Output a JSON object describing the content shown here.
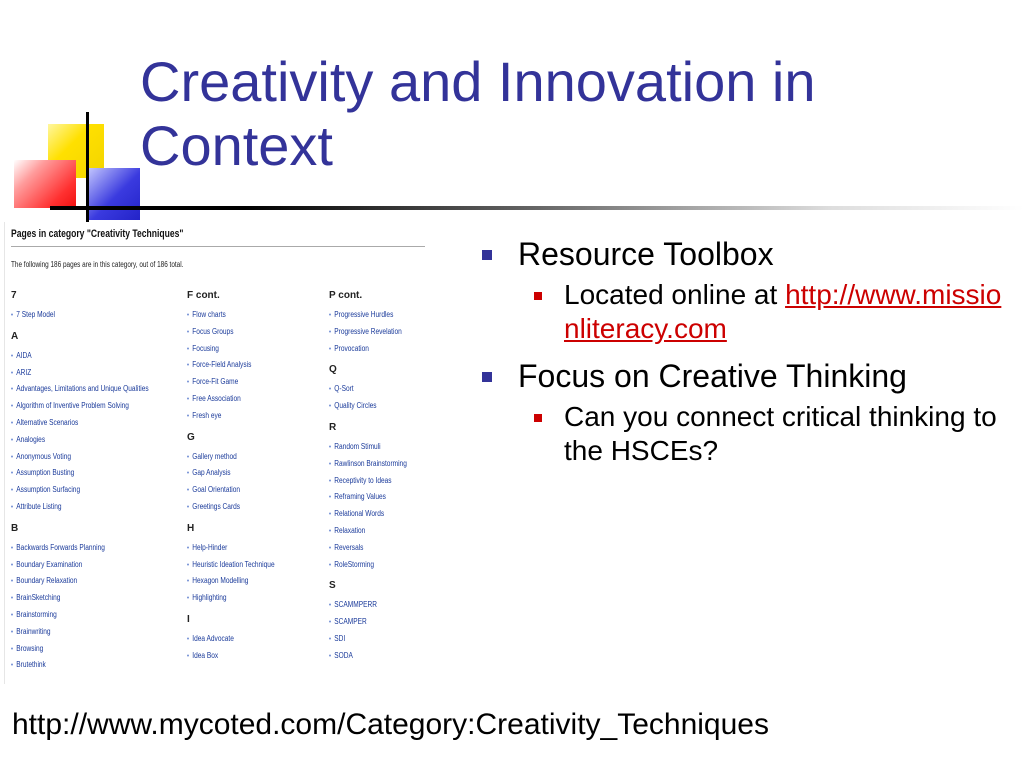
{
  "slide": {
    "title": "Creativity and Innovation in Context",
    "footer_url": "http://www.mycoted.com/Category:Creativity_Techniques",
    "accent_title": "#333399",
    "accent_bullet": "#333399",
    "accent_sub_bullet": "#cc0000"
  },
  "bullets": [
    {
      "text": "Resource Toolbox",
      "sub": {
        "prefix": "Located online at",
        "link": "http://www.missionliteracy.com"
      }
    },
    {
      "text": "Focus on Creative Thinking",
      "sub": {
        "text": "Can you connect critical thinking to the HSCEs?"
      }
    }
  ],
  "screenshot": {
    "title": "Pages in category \"Creativity Techniques\"",
    "subtitle": "The following 186 pages are in this category, out of 186 total.",
    "columns": [
      {
        "sections": [
          {
            "heading": "7",
            "items": [
              "7 Step Model"
            ]
          },
          {
            "heading": "A",
            "items": [
              "AIDA",
              "ARIZ",
              "Advantages, Limitations and Unique Qualities",
              "Algorithm of Inventive Problem Solving",
              "Alternative Scenarios",
              "Analogies",
              "Anonymous Voting",
              "Assumption Busting",
              "Assumption Surfacing",
              "Attribute Listing"
            ]
          },
          {
            "heading": "B",
            "items": [
              "Backwards Forwards Planning",
              "Boundary Examination",
              "Boundary Relaxation",
              "BrainSketching",
              "Brainstorming",
              "Brainwriting",
              "Browsing",
              "Brutethink"
            ]
          }
        ]
      },
      {
        "sections": [
          {
            "heading": "F cont.",
            "items": [
              "Flow charts",
              "Focus Groups",
              "Focusing",
              "Force-Field Analysis",
              "Force-Fit Game",
              "Free Association",
              "Fresh eye"
            ]
          },
          {
            "heading": "G",
            "items": [
              "Gallery method",
              "Gap Analysis",
              "Goal Orientation",
              "Greetings Cards"
            ]
          },
          {
            "heading": "H",
            "items": [
              "Help-Hinder",
              "Heuristic Ideation Technique",
              "Hexagon Modelling",
              "Highlighting"
            ]
          },
          {
            "heading": "I",
            "items": [
              "Idea Advocate",
              "Idea Box"
            ]
          }
        ]
      },
      {
        "sections": [
          {
            "heading": "P cont.",
            "items": [
              "Progressive Hurdles",
              "Progressive Revelation",
              "Provocation"
            ]
          },
          {
            "heading": "Q",
            "items": [
              "Q-Sort",
              "Quality Circles"
            ]
          },
          {
            "heading": "R",
            "items": [
              "Random Stimuli",
              "Rawlinson Brainstorming",
              "Receptivity to Ideas",
              "Reframing Values",
              "Relational Words",
              "Relaxation",
              "Reversals",
              "RoleStorming"
            ]
          },
          {
            "heading": "S",
            "items": [
              "SCAMMPERR",
              "SCAMPER",
              "SDI",
              "SODA"
            ]
          }
        ]
      }
    ]
  }
}
